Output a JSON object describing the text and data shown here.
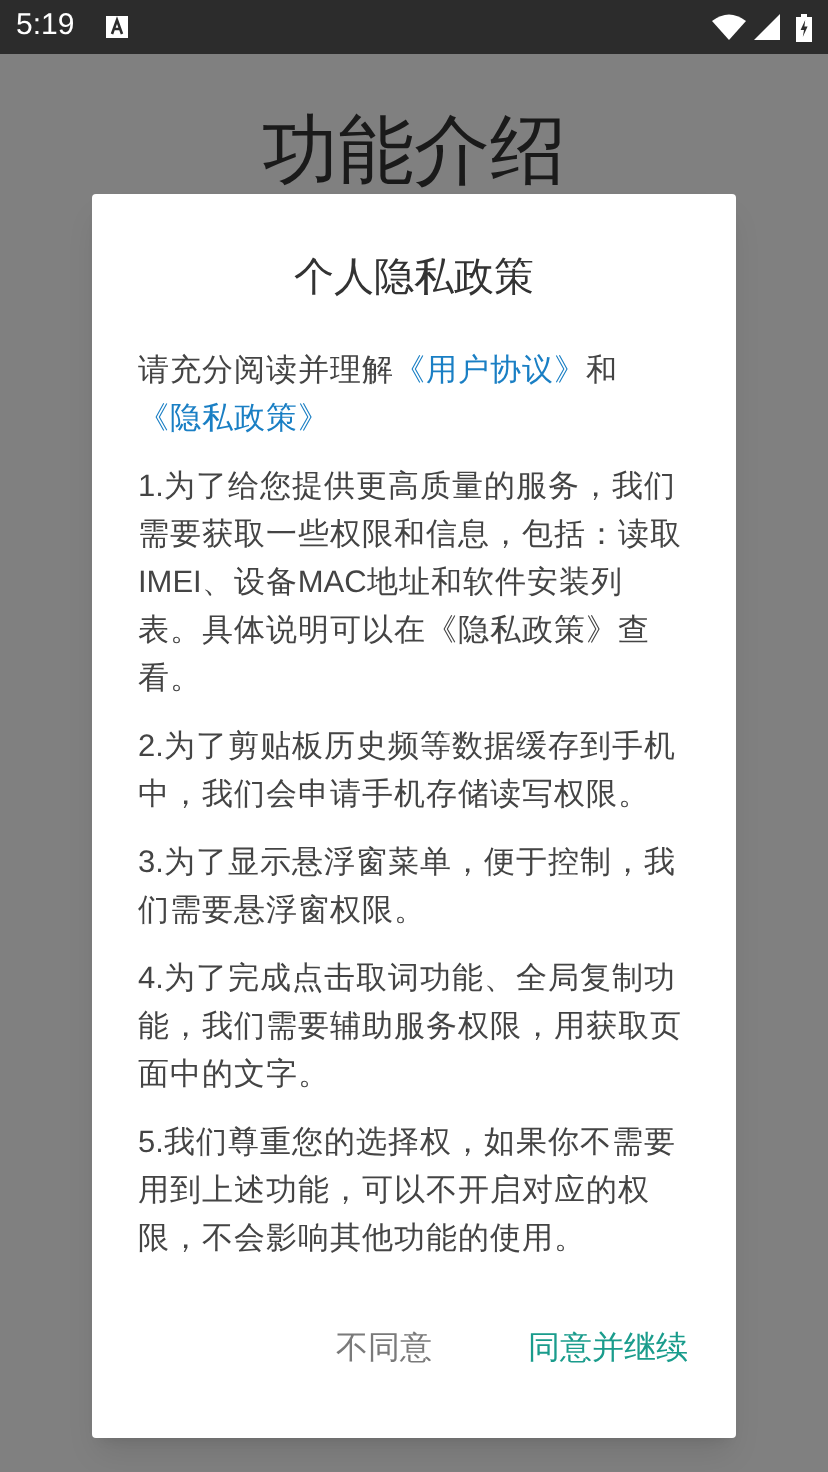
{
  "status_bar": {
    "time": "5:19"
  },
  "page": {
    "title": "功能介绍"
  },
  "dialog": {
    "title": "个人隐私政策",
    "intro": [
      {
        "kind": "text",
        "text": "请充分阅读并理解"
      },
      {
        "kind": "link",
        "text": "《用户协议》"
      },
      {
        "kind": "text",
        "text": "和"
      },
      {
        "kind": "link",
        "text": "《隐私政策》"
      }
    ],
    "paragraphs": [
      "1.为了给您提供更高质量的服务，我们需要获取一些权限和信息，包括：读取IMEI、设备MAC地址和软件安装列表。具体说明可以在《隐私政策》查看。",
      "2.为了剪贴板历史频等数据缓存到手机中，我们会申请手机存储读写权限。",
      "3.为了显示悬浮窗菜单，便于控制，我们需要悬浮窗权限。",
      "4.为了完成点击取词功能、全局复制功能，我们需要辅助服务权限，用获取页面中的文字。",
      "5.我们尊重您的选择权，如果你不需要用到上述功能，可以不开启对应的权限，不会影响其他功能的使用。"
    ],
    "buttons": [
      {
        "kind": "secondary",
        "label": "不同意"
      },
      {
        "kind": "primary",
        "label": "同意并继续"
      }
    ]
  }
}
